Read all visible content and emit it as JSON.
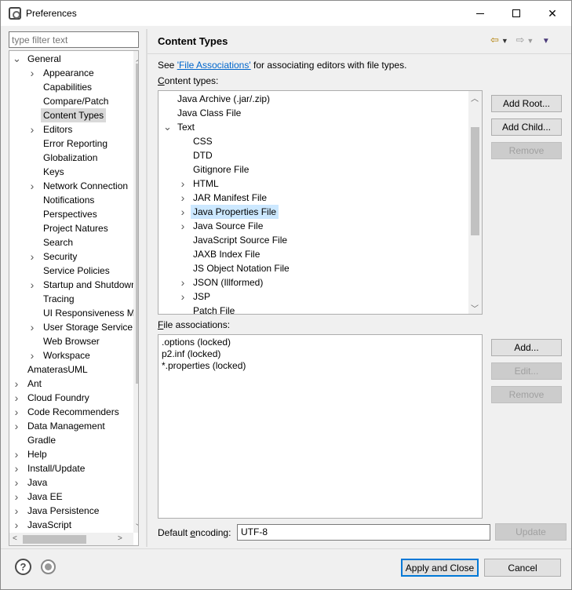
{
  "window": {
    "title": "Preferences"
  },
  "filter": {
    "placeholder": "type filter text"
  },
  "nav_tree": [
    {
      "label": "General",
      "depth": 0,
      "expander": "expanded"
    },
    {
      "label": "Appearance",
      "depth": 1,
      "expander": "collapsed"
    },
    {
      "label": "Capabilities",
      "depth": 1,
      "expander": "none"
    },
    {
      "label": "Compare/Patch",
      "depth": 1,
      "expander": "none"
    },
    {
      "label": "Content Types",
      "depth": 1,
      "expander": "none",
      "selected": true
    },
    {
      "label": "Editors",
      "depth": 1,
      "expander": "collapsed"
    },
    {
      "label": "Error Reporting",
      "depth": 1,
      "expander": "none"
    },
    {
      "label": "Globalization",
      "depth": 1,
      "expander": "none"
    },
    {
      "label": "Keys",
      "depth": 1,
      "expander": "none"
    },
    {
      "label": "Network Connection",
      "depth": 1,
      "expander": "collapsed"
    },
    {
      "label": "Notifications",
      "depth": 1,
      "expander": "none"
    },
    {
      "label": "Perspectives",
      "depth": 1,
      "expander": "none"
    },
    {
      "label": "Project Natures",
      "depth": 1,
      "expander": "none"
    },
    {
      "label": "Search",
      "depth": 1,
      "expander": "none"
    },
    {
      "label": "Security",
      "depth": 1,
      "expander": "collapsed"
    },
    {
      "label": "Service Policies",
      "depth": 1,
      "expander": "none"
    },
    {
      "label": "Startup and Shutdown",
      "depth": 1,
      "expander": "collapsed"
    },
    {
      "label": "Tracing",
      "depth": 1,
      "expander": "none"
    },
    {
      "label": "UI Responsiveness Monitoring",
      "depth": 1,
      "expander": "none"
    },
    {
      "label": "User Storage Service",
      "depth": 1,
      "expander": "collapsed"
    },
    {
      "label": "Web Browser",
      "depth": 1,
      "expander": "none"
    },
    {
      "label": "Workspace",
      "depth": 1,
      "expander": "collapsed"
    },
    {
      "label": "AmaterasUML",
      "depth": 0,
      "expander": "none"
    },
    {
      "label": "Ant",
      "depth": 0,
      "expander": "collapsed"
    },
    {
      "label": "Cloud Foundry",
      "depth": 0,
      "expander": "collapsed"
    },
    {
      "label": "Code Recommenders",
      "depth": 0,
      "expander": "collapsed"
    },
    {
      "label": "Data Management",
      "depth": 0,
      "expander": "collapsed"
    },
    {
      "label": "Gradle",
      "depth": 0,
      "expander": "none"
    },
    {
      "label": "Help",
      "depth": 0,
      "expander": "collapsed"
    },
    {
      "label": "Install/Update",
      "depth": 0,
      "expander": "collapsed"
    },
    {
      "label": "Java",
      "depth": 0,
      "expander": "collapsed"
    },
    {
      "label": "Java EE",
      "depth": 0,
      "expander": "collapsed"
    },
    {
      "label": "Java Persistence",
      "depth": 0,
      "expander": "collapsed"
    },
    {
      "label": "JavaScript",
      "depth": 0,
      "expander": "collapsed"
    }
  ],
  "page": {
    "title": "Content Types",
    "desc_prefix": "See ",
    "desc_link": "'File Associations'",
    "desc_suffix": " for associating editors with file types.",
    "content_types_label_mnemonic": "C",
    "content_types_label_rest": "ontent types:"
  },
  "content_tree": [
    {
      "label": "Java Archive (.jar/.zip)",
      "depth": 0,
      "expander": "none"
    },
    {
      "label": "Java Class File",
      "depth": 0,
      "expander": "none"
    },
    {
      "label": "Text",
      "depth": 0,
      "expander": "expanded"
    },
    {
      "label": "CSS",
      "depth": 1,
      "expander": "none"
    },
    {
      "label": "DTD",
      "depth": 1,
      "expander": "none"
    },
    {
      "label": "Gitignore File",
      "depth": 1,
      "expander": "none"
    },
    {
      "label": "HTML",
      "depth": 1,
      "expander": "collapsed"
    },
    {
      "label": "JAR Manifest File",
      "depth": 1,
      "expander": "collapsed"
    },
    {
      "label": "Java Properties File",
      "depth": 1,
      "expander": "collapsed",
      "selected": true
    },
    {
      "label": "Java Source File",
      "depth": 1,
      "expander": "collapsed"
    },
    {
      "label": "JavaScript Source File",
      "depth": 1,
      "expander": "none"
    },
    {
      "label": "JAXB Index File",
      "depth": 1,
      "expander": "none"
    },
    {
      "label": "JS Object Notation File",
      "depth": 1,
      "expander": "none"
    },
    {
      "label": "JSON (Illformed)",
      "depth": 1,
      "expander": "collapsed"
    },
    {
      "label": "JSP",
      "depth": 1,
      "expander": "collapsed"
    },
    {
      "label": "Patch File",
      "depth": 1,
      "expander": "none"
    }
  ],
  "buttons": {
    "add_root": "Add Root...",
    "add_child": "Add Child...",
    "remove_top": "Remove",
    "add": "Add...",
    "edit": "Edit...",
    "remove_bottom": "Remove",
    "update": "Update",
    "apply_close": "Apply and Close",
    "cancel": "Cancel"
  },
  "file_assoc": {
    "label_mnemonic": "F",
    "label_rest": "ile associations:",
    "items": [
      ".options (locked)",
      "p2.inf (locked)",
      "*.properties (locked)"
    ]
  },
  "encoding": {
    "label_pre": "Default ",
    "label_mnemonic": "e",
    "label_post": "ncoding:",
    "value": "UTF-8"
  },
  "colors": {
    "accent": "#0078d7",
    "selection": "#cce8ff",
    "link": "#0066cc"
  }
}
